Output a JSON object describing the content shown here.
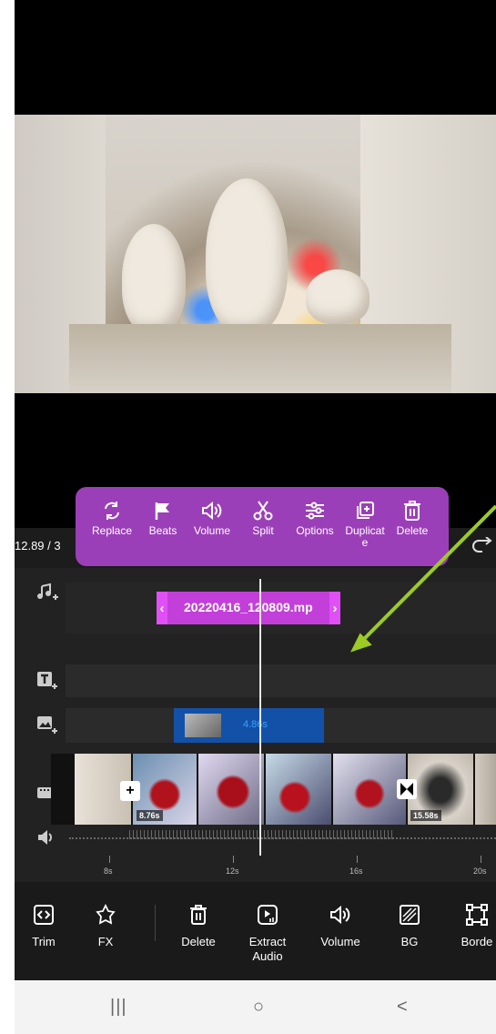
{
  "clip_toolbar": {
    "items": [
      {
        "label": "Replace",
        "icon": "replace-icon"
      },
      {
        "label": "Beats",
        "icon": "flag-icon"
      },
      {
        "label": "Volume",
        "icon": "volume-icon"
      },
      {
        "label": "Split",
        "icon": "scissors-icon"
      },
      {
        "label": "Options",
        "icon": "sliders-icon"
      },
      {
        "label": "Duplicat\ne",
        "icon": "duplicate-icon"
      },
      {
        "label": "Delete",
        "icon": "trash-icon"
      }
    ],
    "color": "#9b3fb8"
  },
  "timeline": {
    "current_time": "12.89 / 3",
    "audio_clip": {
      "name": "20220416_120809.mp",
      "color": "#c33fd9"
    },
    "pip_clip": {
      "duration": "4.86s"
    },
    "main_track": {
      "badges": [
        "8.76s",
        "15.58s"
      ],
      "transition_add": "+"
    },
    "ruler": [
      "8s",
      "12s",
      "16s",
      "20s"
    ]
  },
  "bottom_toolbar": {
    "items": [
      {
        "label": "Trim",
        "icon": "trim-icon"
      },
      {
        "label": "FX",
        "icon": "fx-star-icon"
      },
      {
        "label": "Delete",
        "icon": "trash-icon"
      },
      {
        "label": "Extract\nAudio",
        "icon": "extract-audio-icon"
      },
      {
        "label": "Volume",
        "icon": "volume-icon"
      },
      {
        "label": "BG",
        "icon": "background-icon"
      },
      {
        "label": "Borde",
        "icon": "border-icon"
      }
    ]
  },
  "nav_bar": {
    "recents": "|||",
    "home": "○",
    "back": "<"
  },
  "annotation": {
    "arrow_color": "#9ccc23"
  }
}
